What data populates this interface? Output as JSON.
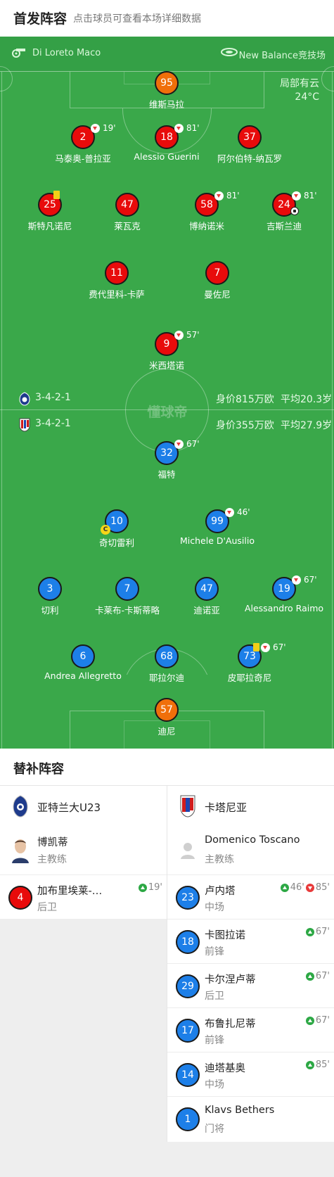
{
  "header": {
    "title": "首发阵容",
    "subtitle": "点击球员可查看本场详细数据"
  },
  "match": {
    "referee": "Di Loreto Maco",
    "venue": "New Balance竞技场",
    "weather": "局部有云",
    "temperature": "24°C",
    "watermark": "懂球帝"
  },
  "home": {
    "formation": "3-4-2-1",
    "value": "身价815万欧",
    "age": "平均20.3岁",
    "color": "#e80b0b"
  },
  "away": {
    "formation": "3-4-2-1",
    "value": "身价355万欧",
    "age": "平均27.9岁",
    "color": "#1d7fe8"
  },
  "home_players": [
    {
      "num": "95",
      "name": "维斯马拉",
      "gk": true
    },
    {
      "num": "2",
      "name": "马泰奥-普拉亚",
      "sub_out": "19'"
    },
    {
      "num": "18",
      "name": "Alessio Guerini",
      "sub_out": "81'"
    },
    {
      "num": "37",
      "name": "阿尔伯特-纳瓦罗"
    },
    {
      "num": "25",
      "name": "斯特凡诺尼",
      "yellow": true
    },
    {
      "num": "47",
      "name": "莱瓦克"
    },
    {
      "num": "58",
      "name": "博纳诺米",
      "sub_out": "81'"
    },
    {
      "num": "24",
      "name": "吉斯兰迪",
      "sub_out": "81'",
      "goal": true
    },
    {
      "num": "11",
      "name": "费代里科-卡萨"
    },
    {
      "num": "7",
      "name": "曼佐尼"
    },
    {
      "num": "9",
      "name": "米西塔诺",
      "sub_out": "57'"
    }
  ],
  "away_players": [
    {
      "num": "32",
      "name": "福特",
      "sub_out": "67'"
    },
    {
      "num": "10",
      "name": "奇切雷利",
      "captain": "C"
    },
    {
      "num": "99",
      "name": "Michele D'Ausilio",
      "sub_out": "46'"
    },
    {
      "num": "3",
      "name": "切利"
    },
    {
      "num": "7",
      "name": "卡莱布-卡斯蒂略"
    },
    {
      "num": "47",
      "name": "迪诺亚"
    },
    {
      "num": "19",
      "name": "Alessandro Raimo",
      "sub_out": "67'"
    },
    {
      "num": "6",
      "name": "Andrea Allegretto"
    },
    {
      "num": "68",
      "name": "耶拉尔迪"
    },
    {
      "num": "73",
      "name": "皮耶拉奇尼",
      "sub_out": "67'",
      "yellow": true
    },
    {
      "num": "57",
      "name": "迪尼",
      "gk": true
    }
  ],
  "subs": {
    "title": "替补阵容",
    "home": {
      "team": "亚特兰大U23",
      "coach": {
        "name": "博凯蒂",
        "role": "主教练"
      },
      "players": [
        {
          "num": "4",
          "name": "加布里埃莱-…",
          "pos": "后卫",
          "in": "19'"
        }
      ]
    },
    "away": {
      "team": "卡塔尼亚",
      "coach": {
        "name": "Domenico Toscano",
        "role": "主教练"
      },
      "players": [
        {
          "num": "23",
          "name": "卢内塔",
          "pos": "中场",
          "in": "46'",
          "out": "85'"
        },
        {
          "num": "18",
          "name": "卡图拉诺",
          "pos": "前锋",
          "in": "67'"
        },
        {
          "num": "29",
          "name": "卡尔涅卢蒂",
          "pos": "后卫",
          "in": "67'"
        },
        {
          "num": "17",
          "name": "布鲁扎尼蒂",
          "pos": "前锋",
          "in": "67'"
        },
        {
          "num": "14",
          "name": "迪塔基奥",
          "pos": "中场",
          "in": "85'"
        },
        {
          "num": "1",
          "name": "Klavs Bethers",
          "pos": "门将"
        }
      ]
    }
  }
}
